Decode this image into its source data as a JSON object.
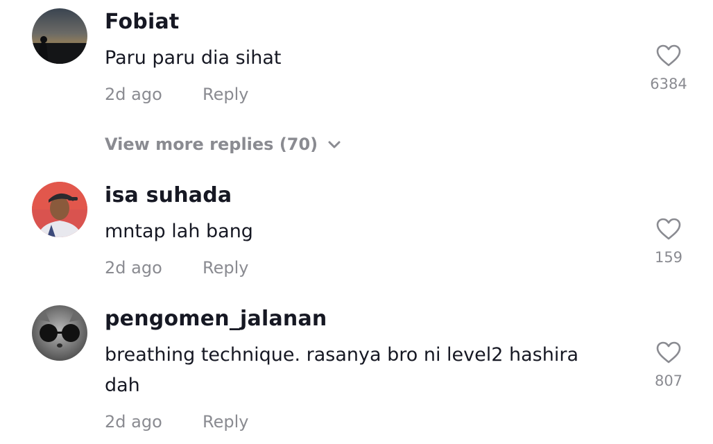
{
  "comments": [
    {
      "username": "Fobiat",
      "text": "Paru paru dia sihat",
      "time": "2d ago",
      "reply_label": "Reply",
      "likes": "6384"
    },
    {
      "username": "isa suhada",
      "text": "mntap lah bang",
      "time": "2d ago",
      "reply_label": "Reply",
      "likes": "159"
    },
    {
      "username": "pengomen_jalanan",
      "text": "breathing technique. rasanya bro ni level2 hashira dah",
      "time": "2d ago",
      "reply_label": "Reply",
      "likes": "807"
    }
  ],
  "view_more_replies": "View more replies (70)",
  "icons": {
    "like": "heart-outline-icon",
    "expand": "chevron-down-icon"
  },
  "colors": {
    "primary_text": "#161823",
    "secondary_text": "#8a8b91",
    "background": "#ffffff"
  }
}
